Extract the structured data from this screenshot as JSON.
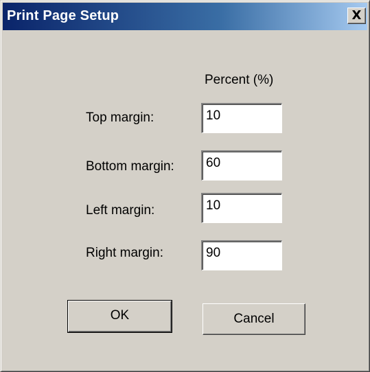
{
  "window": {
    "title": "Print Page Setup",
    "close_label": "X"
  },
  "form": {
    "column_header": "Percent (%)",
    "fields": [
      {
        "label": "Top margin:",
        "value": "10"
      },
      {
        "label": "Bottom margin:",
        "value": "60"
      },
      {
        "label": "Left margin:",
        "value": "10"
      },
      {
        "label": "Right margin:",
        "value": "90"
      }
    ]
  },
  "buttons": {
    "ok_label": "OK",
    "cancel_label": "Cancel"
  }
}
